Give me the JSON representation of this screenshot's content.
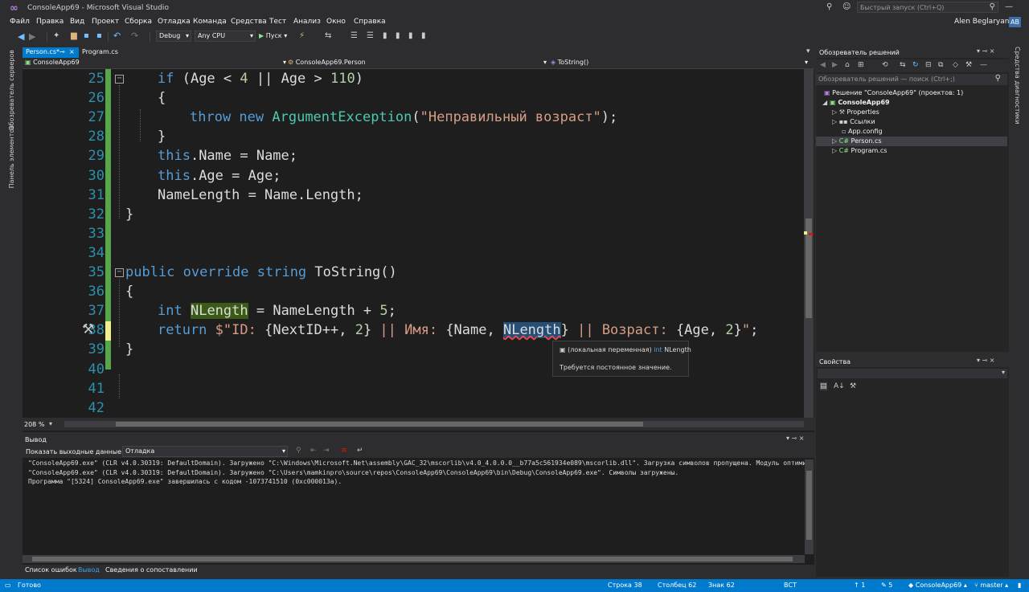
{
  "window": {
    "title": "ConsoleApp69 - Microsoft Visual Studio",
    "quick_launch": "Быстрый запуск (Ctrl+Q)",
    "user": "Alen Beglaryan",
    "user_initials": "AB"
  },
  "menu": [
    "Файл",
    "Правка",
    "Вид",
    "Проект",
    "Сборка",
    "Отладка",
    "Команда",
    "Средства",
    "Тест",
    "Анализ",
    "Окно",
    "Справка"
  ],
  "toolbar": {
    "config": "Debug",
    "platform": "Any CPU",
    "start": "Пуск"
  },
  "side_tabs": {
    "server_explorer": "Обозреватель серверов",
    "toolbox": "Панель элементов",
    "diag": "Средства диагностики"
  },
  "editor": {
    "tabs": [
      {
        "label": "Person.cs*"
      },
      {
        "label": "Program.cs"
      }
    ],
    "nav": {
      "project": "ConsoleApp69",
      "class": "ConsoleApp69.Person",
      "member": "ToString()"
    },
    "zoom": "208 %",
    "lines": [
      {
        "n": "25",
        "html": "<span class='kw'>if</span> (Age &lt; <span class='num'>4</span> || Age &gt; <span class='num'>110</span>)",
        "indent": 1
      },
      {
        "n": "26",
        "html": "{",
        "indent": 1
      },
      {
        "n": "27",
        "html": "<span class='kw'>throw new</span> <span class='cls'>ArgumentException</span>(<span class='str'>\"Неправильный возраст\"</span>);",
        "indent": 2
      },
      {
        "n": "28",
        "html": "}",
        "indent": 1
      },
      {
        "n": "29",
        "html": "<span class='kw'>this</span>.Name = Name;",
        "indent": 1
      },
      {
        "n": "30",
        "html": "<span class='kw'>this</span>.Age = Age;",
        "indent": 1
      },
      {
        "n": "31",
        "html": "NameLength = Name.Length;",
        "indent": 1
      },
      {
        "n": "32",
        "html": "}",
        "indent": 0
      },
      {
        "n": "33",
        "html": "",
        "indent": 0
      },
      {
        "n": "34",
        "html": "",
        "indent": 0
      },
      {
        "n": "35",
        "html": "<span class='kw'>public override string</span> ToString()",
        "indent": 0
      },
      {
        "n": "36",
        "html": "{",
        "indent": 0
      },
      {
        "n": "37",
        "html": "<span class='kw'>int</span> <span style='background:#3a5a16'>NLength</span> = NameLength + <span class='num'>5</span>;",
        "indent": 1
      },
      {
        "n": "38",
        "html": "<span class='kw'>return</span> <span class='str'>$\"ID: </span>{NextID++, <span class='num'>2</span>}<span class='str'> || Имя: </span>{Name, <span style='background:#264f78;text-decoration:underline wavy #f44;'>NLength</span>}<span class='str'> || Возраст: </span>{Age, <span class='num'>2</span>}<span class='str'>\"</span>;",
        "indent": 1
      },
      {
        "n": "39",
        "html": "}",
        "indent": 0
      },
      {
        "n": "40",
        "html": "",
        "indent": 0
      },
      {
        "n": "41",
        "html": "",
        "indent": 0
      },
      {
        "n": "42",
        "html": "",
        "indent": 0
      }
    ],
    "tooltip": {
      "line1_prefix": "(локальная переменная)",
      "line1_type": "int",
      "line1_name": "NLength",
      "line2": "Требуется постоянное значение."
    }
  },
  "output": {
    "title": "Вывод",
    "show_label": "Показать выходные данные из:",
    "source": "Отладка",
    "lines": [
      "\"ConsoleApp69.exe\" (CLR v4.0.30319: DefaultDomain). Загружено \"C:\\Windows\\Microsoft.Net\\assembly\\GAC_32\\mscorlib\\v4.0_4.0.0.0__b77a5c561934e089\\mscorlib.dll\". Загрузка символов пропущена. Модуль оптими",
      "\"ConsoleApp69.exe\" (CLR v4.0.30319: DefaultDomain). Загружено \"C:\\Users\\mamkinpro\\source\\repos\\ConsoleApp69\\ConsoleApp69\\bin\\Debug\\ConsoleApp69.exe\". Символы загружены.",
      "Программа \"[5324] ConsoleApp69.exe\" завершилась с кодом -1073741510 (0xc000013a)."
    ]
  },
  "bottom_tabs": [
    "Список ошибок",
    "Вывод",
    "Сведения о сопоставлении"
  ],
  "solution": {
    "title": "Обозреватель решений",
    "search": "Обозреватель решений — поиск (Ctrl+;)",
    "items": [
      {
        "label": "Решение \"ConsoleApp69\"  (проектов: 1)",
        "level": 0
      },
      {
        "label": "ConsoleApp69",
        "level": 1,
        "bold": true
      },
      {
        "label": "Properties",
        "level": 2
      },
      {
        "label": "Ссылки",
        "level": 2
      },
      {
        "label": "App.config",
        "level": 2
      },
      {
        "label": "Person.cs",
        "level": 2,
        "selected": true
      },
      {
        "label": "Program.cs",
        "level": 2
      }
    ]
  },
  "properties": {
    "title": "Свойства"
  },
  "status": {
    "ready": "Готово",
    "line": "Строка 38",
    "col": "Столбец 62",
    "char": "Знак 62",
    "mode": "ВСТ",
    "up": "1",
    "edits": "5",
    "project": "ConsoleApp69",
    "branch": "master"
  }
}
